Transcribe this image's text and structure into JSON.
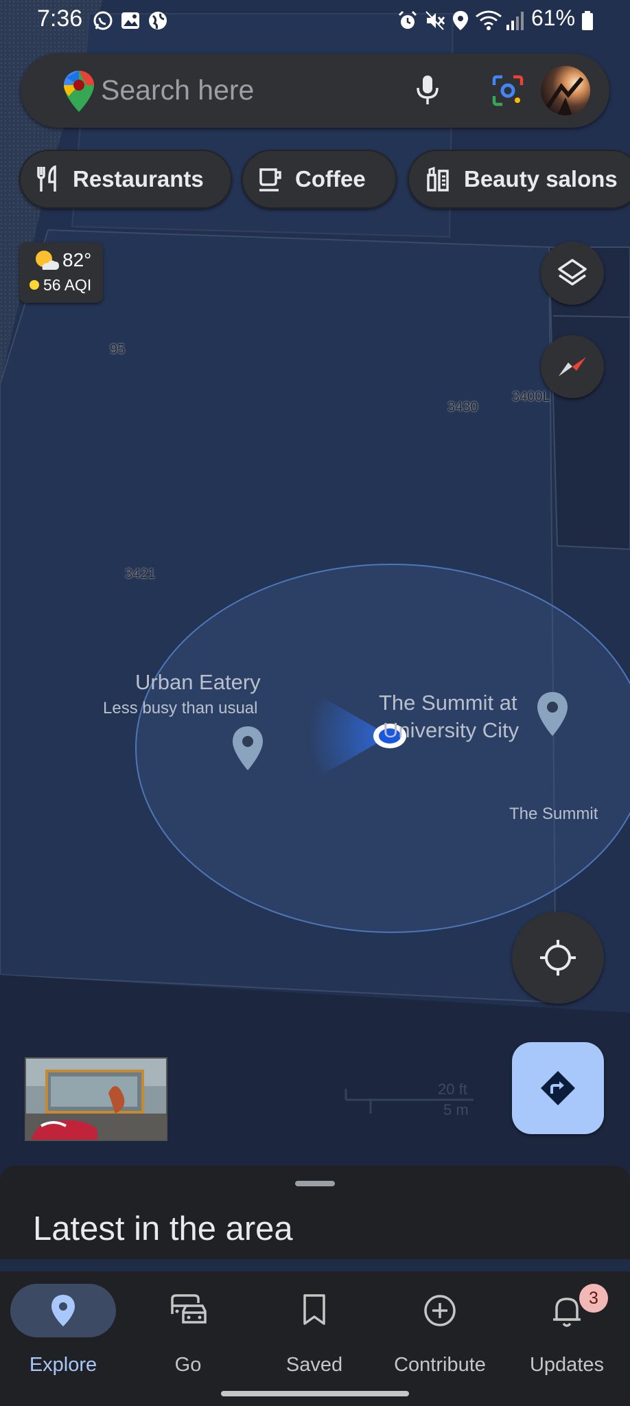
{
  "status_bar": {
    "time": "7:36",
    "battery": "61%",
    "left_icons": [
      "whatsapp-icon",
      "gallery-icon",
      "globe-icon"
    ],
    "right_icons": [
      "alarm-icon",
      "mute-icon",
      "location-icon",
      "wifi-icon",
      "signal-icon",
      "battery-icon"
    ]
  },
  "search": {
    "placeholder": "Search here",
    "icons": [
      "google-maps-logo",
      "mic-icon",
      "lens-icon",
      "avatar"
    ]
  },
  "chips": [
    {
      "label": "Restaurants",
      "icon": "fork-knife-icon"
    },
    {
      "label": "Coffee",
      "icon": "coffee-cup-icon"
    },
    {
      "label": "Beauty salons",
      "icon": "beauty-bottle-icon"
    }
  ],
  "weather": {
    "temperature": "82°",
    "aqi": "56 AQI",
    "icon": "partly-sunny-icon",
    "aqi_color": "#fdd835"
  },
  "map": {
    "labels": [
      "95",
      "3430",
      "3400L",
      "3421"
    ],
    "places": [
      {
        "name": "Urban Eatery",
        "subtitle": "Less busy than usual"
      },
      {
        "name": "The Summit at University City",
        "line1": "The Summit at",
        "line2": "University City"
      },
      {
        "name": "The Summit"
      }
    ],
    "scale": {
      "imperial": "20 ft",
      "metric": "5 m"
    },
    "location_color": "#1a73e8"
  },
  "sheet": {
    "title": "Latest in the area"
  },
  "bottom_nav": {
    "items": [
      {
        "label": "Explore",
        "icon": "pin-icon",
        "active": true
      },
      {
        "label": "Go",
        "icon": "commute-icon",
        "active": false
      },
      {
        "label": "Saved",
        "icon": "bookmark-icon",
        "active": false
      },
      {
        "label": "Contribute",
        "icon": "add-circle-icon",
        "active": false
      },
      {
        "label": "Updates",
        "icon": "bell-icon",
        "active": false,
        "badge": "3"
      }
    ]
  },
  "colors": {
    "map_bg": "#1f2c45",
    "surface": "#303134",
    "accent": "#a8c7fa"
  }
}
